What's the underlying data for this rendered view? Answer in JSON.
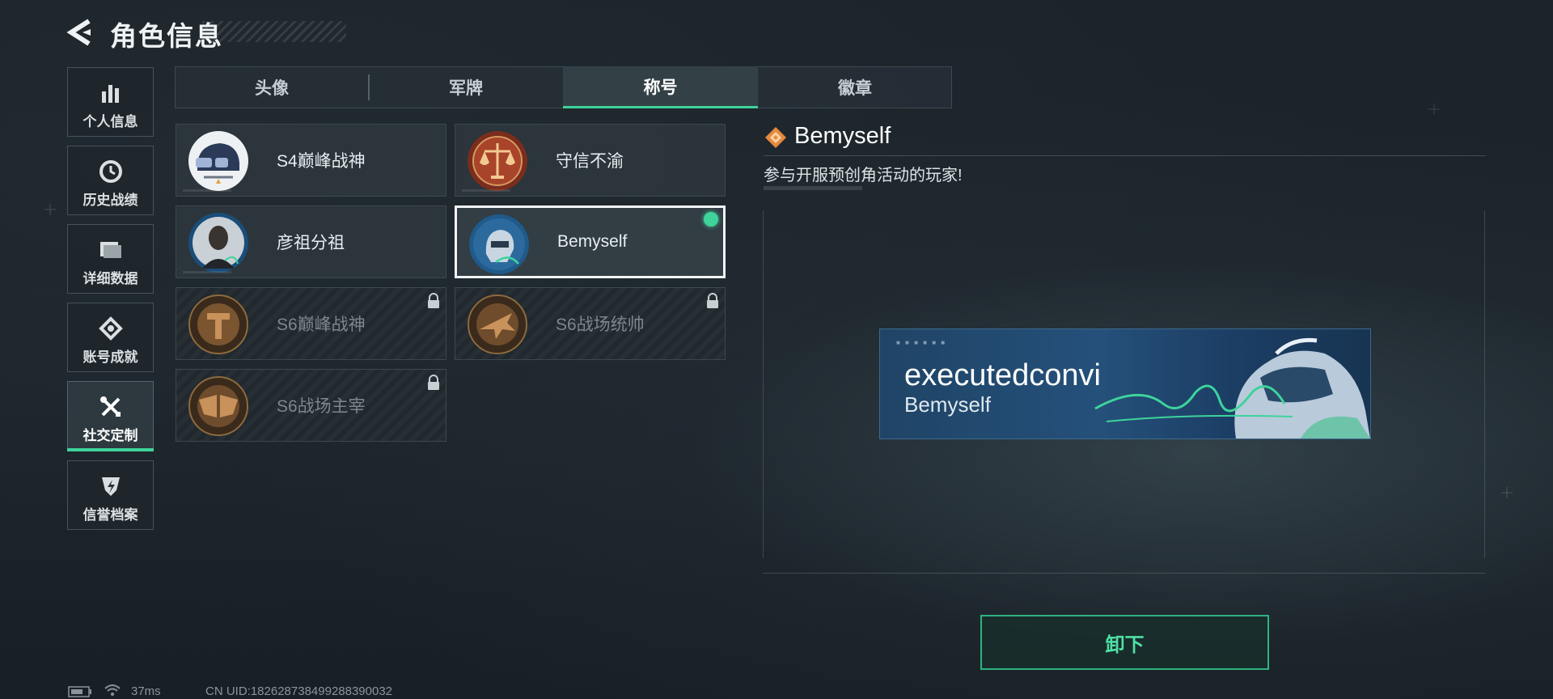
{
  "header": {
    "title": "角色信息",
    "back_icon": "back-arrow-icon"
  },
  "sidebar": {
    "items": [
      {
        "label": "个人信息",
        "icon": "bar-chart-icon"
      },
      {
        "label": "历史战绩",
        "icon": "history-clock-icon"
      },
      {
        "label": "详细数据",
        "icon": "folder-icon"
      },
      {
        "label": "账号成就",
        "icon": "achievement-icon"
      },
      {
        "label": "社交定制",
        "icon": "wrench-screwdriver-icon",
        "active": true
      },
      {
        "label": "信誉档案",
        "icon": "shield-lightning-icon"
      }
    ]
  },
  "tabs": [
    {
      "label": "头像"
    },
    {
      "label": "军牌"
    },
    {
      "label": "称号",
      "active": true
    },
    {
      "label": "徽章"
    }
  ],
  "titles": [
    {
      "name": "S4巅峰战神",
      "locked": false,
      "emblem": "helmet-emblem"
    },
    {
      "name": "守信不渝",
      "locked": false,
      "emblem": "scales-emblem"
    },
    {
      "name": "彦祖分祖",
      "locked": false,
      "emblem": "portrait-emblem"
    },
    {
      "name": "Bemyself",
      "locked": false,
      "selected": true,
      "emblem": "soldier-emblem"
    },
    {
      "name": "S6巅峰战神",
      "locked": true,
      "emblem": "bronze-t-emblem"
    },
    {
      "name": "S6战场统帅",
      "locked": true,
      "emblem": "bronze-jet-emblem"
    },
    {
      "name": "S6战场主宰",
      "locked": true,
      "emblem": "bronze-wings-emblem"
    }
  ],
  "detail": {
    "title": "Bemyself",
    "description": "参与开服预创角活动的玩家!",
    "banner": {
      "player_name": "executedconvi",
      "title": "Bemyself"
    },
    "unequip_label": "卸下"
  },
  "status_bar": {
    "ping": "37ms",
    "uid": "CN UID:182628738499288390032"
  },
  "colors": {
    "accent": "#3ed39b",
    "selected_border": "#f2f5f6",
    "badge_orange": "#e58a3c"
  }
}
